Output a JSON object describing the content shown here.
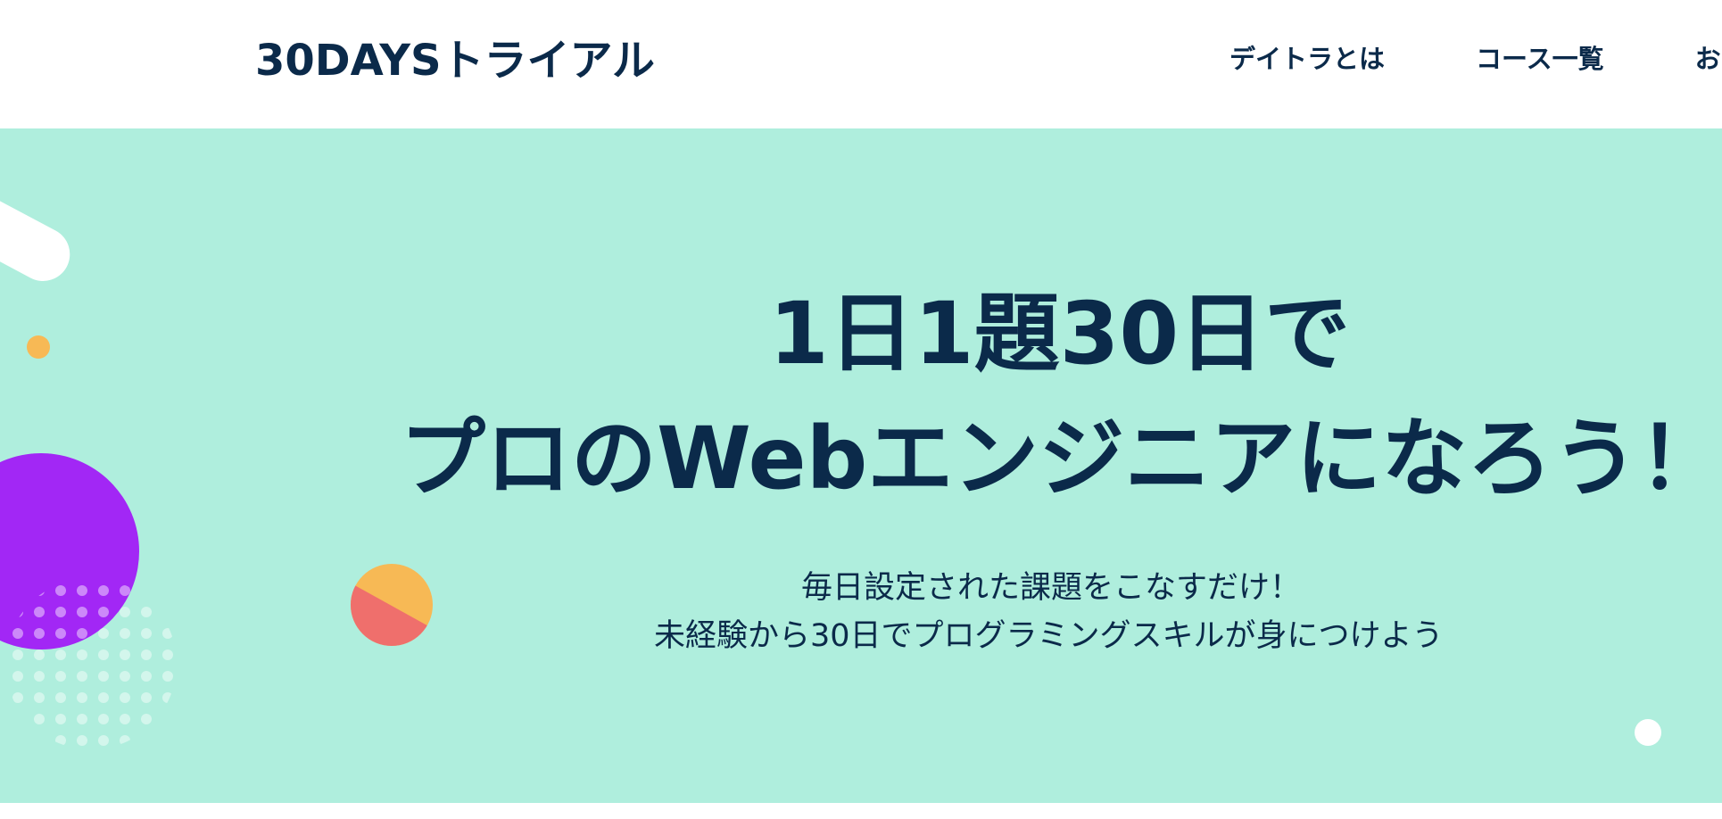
{
  "header": {
    "brand": "30DAYSトライアル",
    "nav": [
      {
        "label": "デイトラとは"
      },
      {
        "label": "コース一覧"
      },
      {
        "label": "お"
      }
    ]
  },
  "hero": {
    "headline_line1": "1日1題30日で",
    "headline_line2": "プロのWebエンジニアになろう！",
    "sub_line1": "毎日設定された課題をこなすだけ！",
    "sub_line2": "未経験から30日でプログラミングスキルが身につけよう"
  },
  "colors": {
    "hero_bg": "#afeedd",
    "text": "#0b2a4a",
    "purple": "#a227f5",
    "yellow": "#f7b955",
    "coral": "#ef6f6c",
    "white": "#ffffff"
  },
  "decorations": [
    "white-pill-shape",
    "yellow-dot",
    "purple-circle",
    "dots-pattern",
    "split-circle",
    "white-dot"
  ]
}
